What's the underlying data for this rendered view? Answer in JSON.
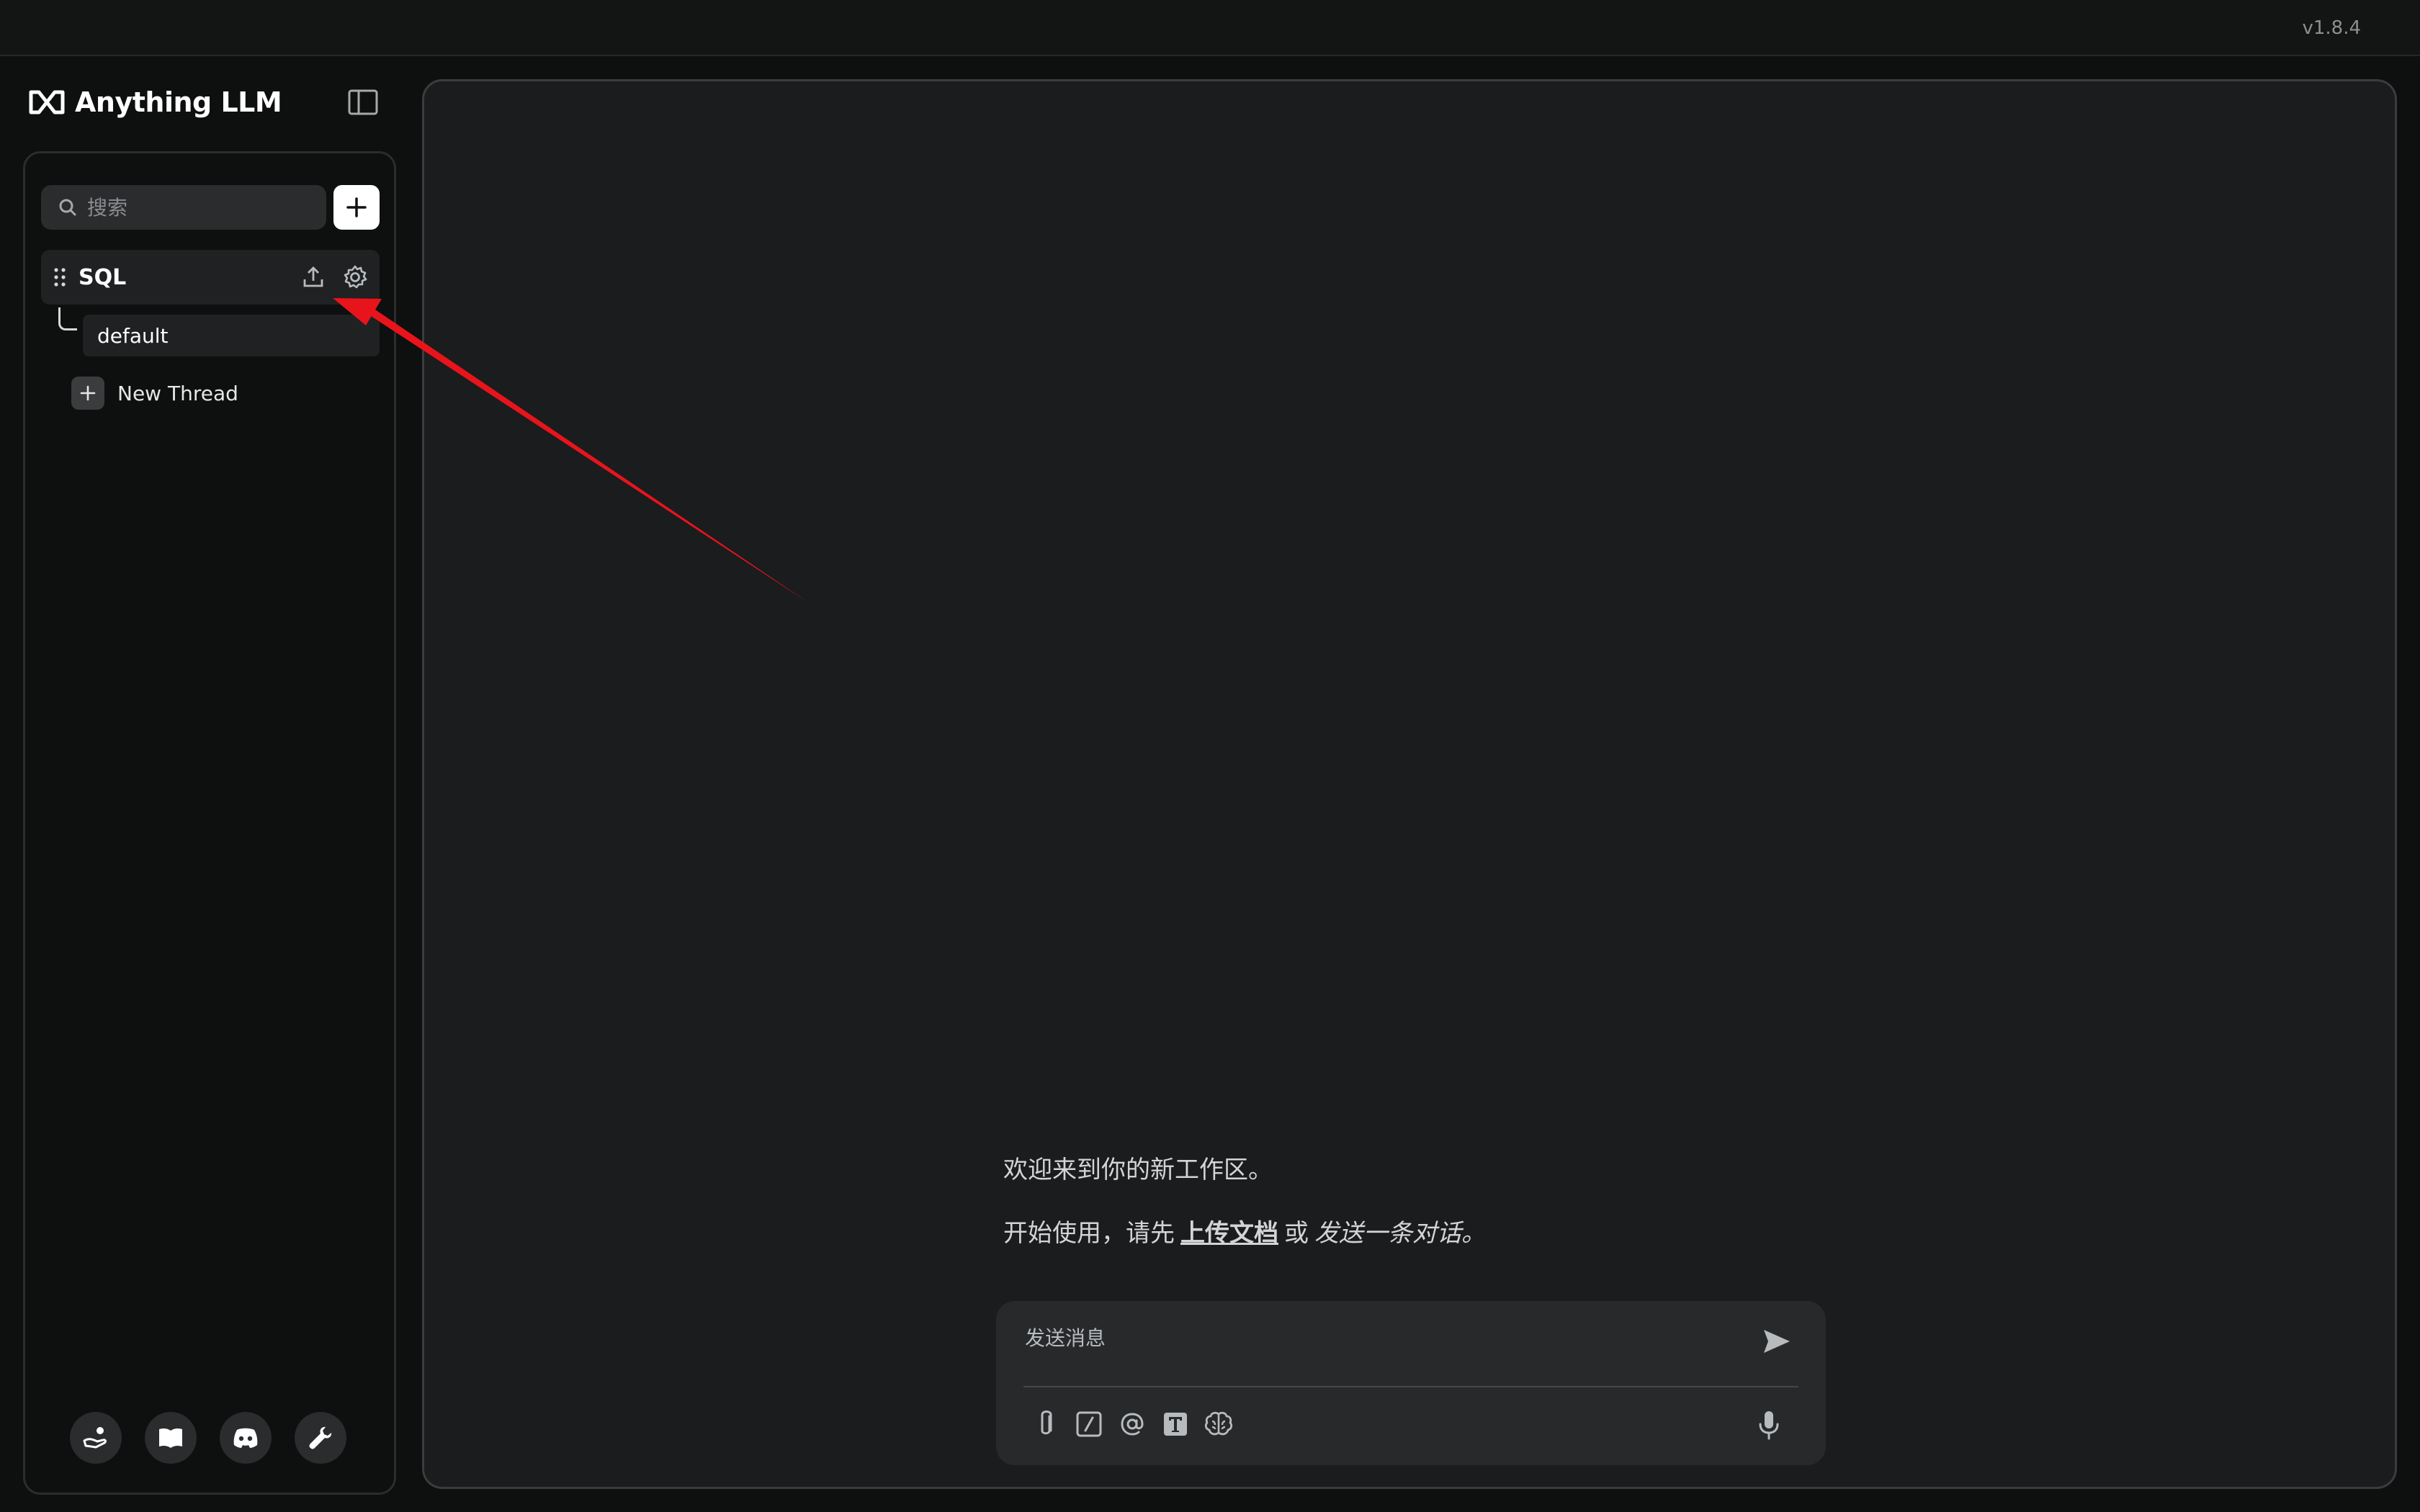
{
  "app": {
    "version": "v1.8.4",
    "brand_name": "Anything LLM"
  },
  "sidebar": {
    "search": {
      "placeholder": "搜索",
      "value": ""
    },
    "workspaces": [
      {
        "name": "SQL",
        "threads": [
          {
            "label": "default"
          }
        ]
      }
    ],
    "new_thread_label": "New Thread",
    "footer_icons": [
      "community-hub-icon",
      "docs-book-icon",
      "discord-icon",
      "settings-wrench-icon"
    ]
  },
  "main": {
    "welcome_text": "欢迎来到你的新工作区。",
    "getting_started": {
      "prefix": "开始使用，请先",
      "upload_link": "上传文档",
      "or_text": "或",
      "send_text": "发送一条对话。"
    },
    "composer": {
      "placeholder": "发送消息",
      "tool_icons": [
        "paperclip-icon",
        "slash-command-icon",
        "at-mention-icon",
        "text-size-icon",
        "agent-brain-icon"
      ]
    }
  },
  "annotation": {
    "arrow_color": "#e8141b"
  },
  "colors": {
    "background": "#0e0f0f",
    "panel": "#1b1c1e",
    "accent_white": "#ffffff"
  }
}
